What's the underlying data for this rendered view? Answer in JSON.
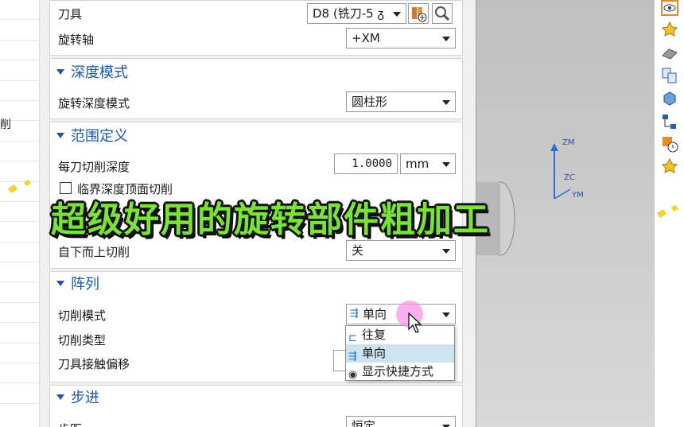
{
  "left_panel": {
    "partial_text": "削"
  },
  "dialog": {
    "tool": {
      "label": "刀具",
      "value": "D8 (铣刀-5 ᵹ"
    },
    "axis": {
      "label": "旋转轴",
      "value": "+XM"
    },
    "depth_mode_section": {
      "title": "深度模式",
      "field_label": "旋转深度模式",
      "value": "圆柱形"
    },
    "range_section": {
      "title": "范围定义",
      "cut_depth_label": "每刀切削深度",
      "cut_depth_value": "1.0000",
      "cut_depth_unit": "mm",
      "critical_depth_label": "临界深度顶面切削"
    },
    "bottom_up": {
      "label": "自下而上切削",
      "value": "关"
    },
    "array_section": {
      "title": "阵列",
      "cut_mode_label": "切削模式",
      "cut_mode_value": "单向",
      "cut_type_label": "切削类型",
      "tool_offset_label": "刀具接触偏移",
      "options": [
        "往复",
        "单向",
        "显示快捷方式"
      ]
    },
    "stepover_section": {
      "title": "步进",
      "step_label": "步距",
      "step_value": "恒定"
    }
  },
  "viewport": {
    "axis_labels": [
      "ZM",
      "ZC",
      "YM"
    ]
  },
  "right_toolbar": {
    "icons": [
      "eye-icon",
      "star-icon",
      "solid-icon",
      "copy-icon",
      "cube-icon",
      "hierarchy-icon",
      "warning-icon",
      "star-icon"
    ]
  },
  "overlay": {
    "title": "超级好用的旋转部件粗加工"
  },
  "colors": {
    "accent": "#1b56a8",
    "overlay_text": "#7be23a",
    "selection": "#cde4f0"
  }
}
